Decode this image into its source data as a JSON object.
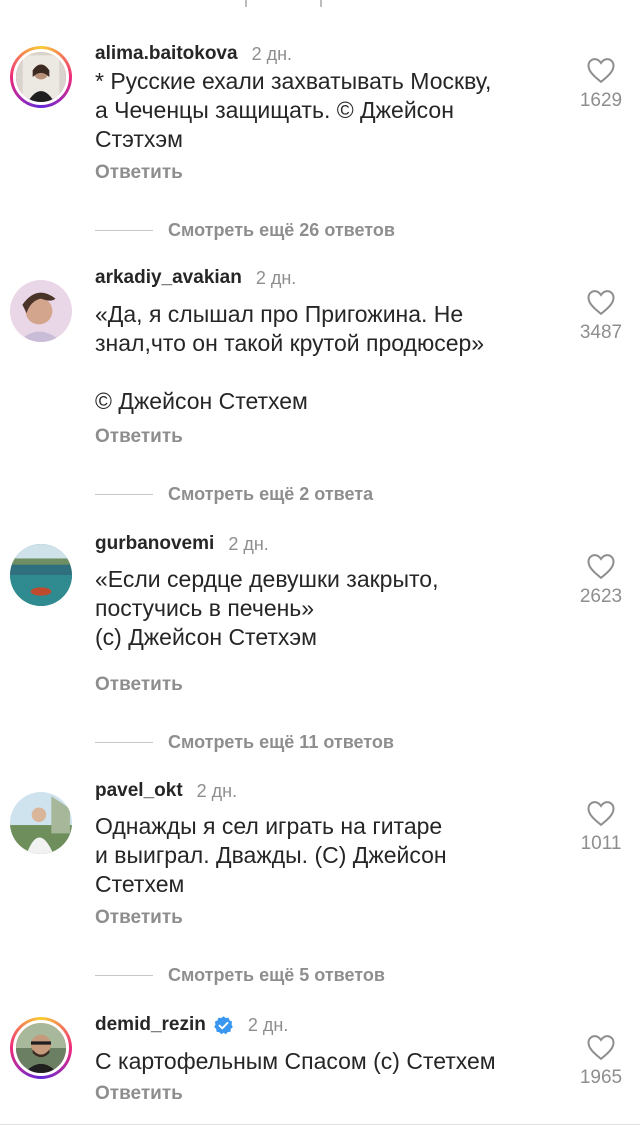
{
  "comments": [
    {
      "username": "alima.baitokova",
      "time": "2 дн.",
      "text": "* Русские ехали захватывать Москву,\nа Чеченцы защищать. © Джейсон\nСтэтхэм",
      "likes": "1629",
      "reply": "Ответить",
      "more": "Смотреть ещё 26 ответов"
    },
    {
      "username": "arkadiy_avakian",
      "time": "2 дн.",
      "text": "«Да, я слышал про Пригожина. Не\nзнал,что он такой крутой продюсер»\n\n© Джейсон Стетхем",
      "likes": "3487",
      "reply": "Ответить",
      "more": "Смотреть ещё 2 ответа"
    },
    {
      "username": "gurbanovemi",
      "time": "2 дн.",
      "text": "«Если сердце девушки закрыто,\nпостучись в печень»\n(с) Джейсон Стетхэм",
      "likes": "2623",
      "reply": "Ответить",
      "more": "Смотреть ещё 11 ответов"
    },
    {
      "username": "pavel_okt",
      "time": "2 дн.",
      "text": "Однажды я сел играть на гитаре\nи выиграл. Дважды. (С) Джейсон\nСтетхем",
      "likes": "1011",
      "reply": "Ответить",
      "more": "Смотреть ещё 5 ответов"
    },
    {
      "username": "demid_rezin",
      "time": "2 дн.",
      "text": "С картофельным Спасом (с) Стетхем",
      "likes": "1965",
      "reply": "Ответить",
      "verified": true
    }
  ],
  "colors": {
    "text": "#262626",
    "secondary": "#8e8e8e",
    "verified": "#3897f0"
  }
}
